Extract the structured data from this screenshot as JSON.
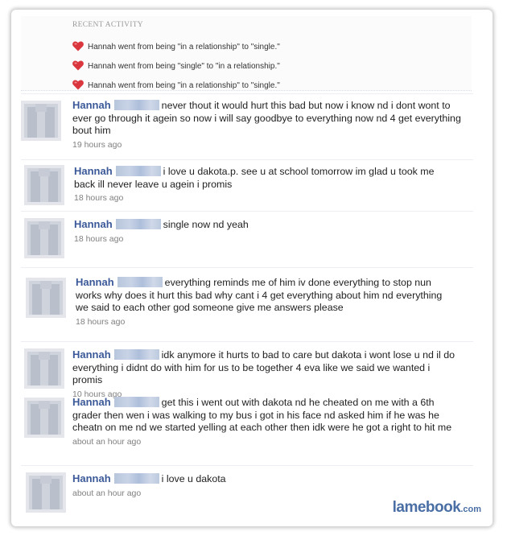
{
  "recent_activity": {
    "title": "RECENT ACTIVITY",
    "items": [
      "Hannah went from being \"in a relationship\" to \"single.\"",
      "Hannah went from being \"single\" to \"in a relationship.\"",
      "Hannah went from being \"in a relationship\" to \"single.\""
    ]
  },
  "stories": [
    {
      "name": "Hannah",
      "text": "never thout it would hurt this bad but now i know nd i dont wont to ever go through it agein so now i will say goodbye to everything now nd 4 get everything bout him",
      "time": "19 hours ago"
    },
    {
      "name": "Hannah",
      "text": "i love u dakota.p. see u at school tomorrow im glad u took me back ill never leave u agein i promis",
      "time": "18 hours ago"
    },
    {
      "name": "Hannah",
      "text": "single now nd yeah",
      "time": "18 hours ago"
    },
    {
      "name": "Hannah",
      "text": "everything reminds me of him iv done everything to stop nun works why does it hurt this bad why cant i 4 get everything about him nd everything we said to each other god someone give me answers please",
      "time": "18 hours ago"
    },
    {
      "name": "Hannah",
      "text": "idk anymore it hurts to bad to care but dakota i wont lose u nd il do everything i didnt do with him for us to be together 4 eva like we said we wanted i promis",
      "time": "10 hours ago"
    },
    {
      "name": "Hannah",
      "text": "get this i went out with dakota nd he cheated on me with a 6th grader then wen i was walking to my bus i got in his face nd asked him if he was he cheatn on me nd we started yelling at each other then idk were he got a right to hit me",
      "time": "about an hour ago"
    },
    {
      "name": "Hannah",
      "text": "i love u dakota",
      "time": "about an hour ago"
    }
  ],
  "branding": {
    "name": "lamebook",
    "tld": ".com"
  },
  "colors": {
    "name_link": "#3b5998",
    "heart": "#d9363e",
    "brand": "#4a6fa5"
  }
}
